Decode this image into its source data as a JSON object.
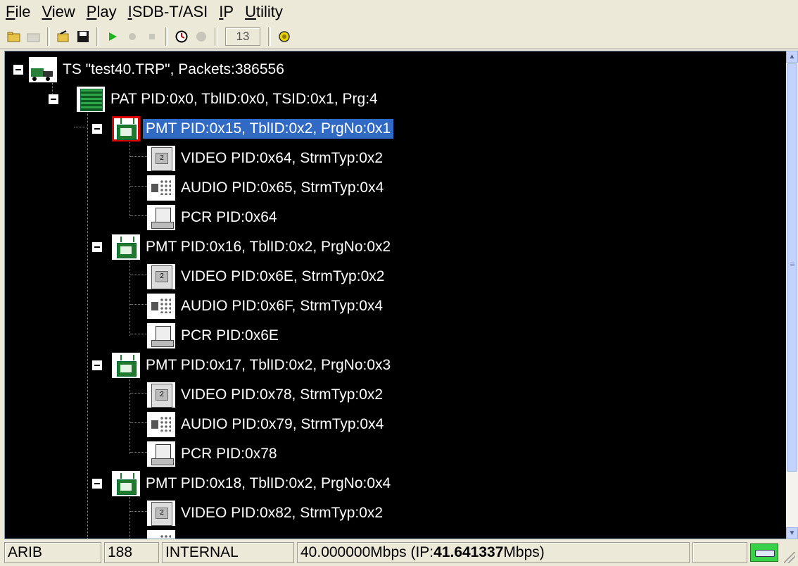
{
  "menu": {
    "items": [
      {
        "label": "File",
        "key": "F"
      },
      {
        "label": "View",
        "key": "V"
      },
      {
        "label": "Play",
        "key": "P"
      },
      {
        "label": "ISDB-T/ASI",
        "key": "I"
      },
      {
        "label": "IP",
        "key": "I"
      },
      {
        "label": "Utility",
        "key": "U"
      }
    ]
  },
  "toolbar": {
    "counter": "13"
  },
  "tree": {
    "ts": "TS \"test40.TRP\", Packets:386556",
    "pat": "PAT PID:0x0, TblID:0x0, TSID:0x1, Prg:4",
    "programs": [
      {
        "pmt": "PMT PID:0x15, TblID:0x2, PrgNo:0x1",
        "video": "VIDEO PID:0x64, StrmTyp:0x2",
        "audio": "AUDIO PID:0x65, StrmTyp:0x4",
        "pcr": "PCR PID:0x64"
      },
      {
        "pmt": "PMT PID:0x16, TblID:0x2, PrgNo:0x2",
        "video": "VIDEO PID:0x6E, StrmTyp:0x2",
        "audio": "AUDIO PID:0x6F, StrmTyp:0x4",
        "pcr": "PCR PID:0x6E"
      },
      {
        "pmt": "PMT PID:0x17, TblID:0x2, PrgNo:0x3",
        "video": "VIDEO PID:0x78, StrmTyp:0x2",
        "audio": "AUDIO PID:0x79, StrmTyp:0x4",
        "pcr": "PCR PID:0x78"
      },
      {
        "pmt": "PMT PID:0x18, TblID:0x2, PrgNo:0x4",
        "video": "VIDEO PID:0x82, StrmTyp:0x2"
      }
    ]
  },
  "status": {
    "standard": "ARIB",
    "packet_size": "188",
    "clock": "INTERNAL",
    "rate_prefix": "40.000000Mbps (IP:",
    "rate_ip": "41.641337",
    "rate_suffix": "Mbps)",
    "led_color": "#39d04a"
  },
  "colors": {
    "tree_bg": "#000000",
    "selection": "#316ac5"
  }
}
